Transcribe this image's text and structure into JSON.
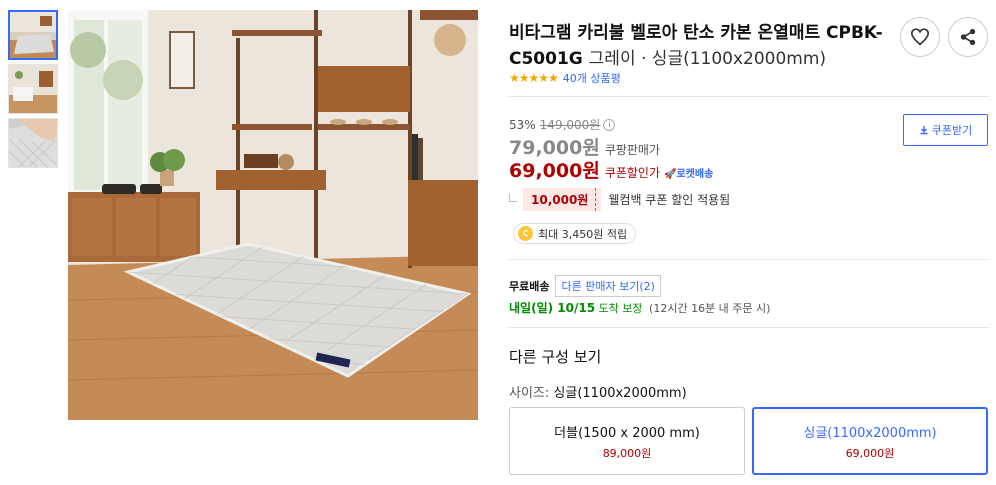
{
  "product": {
    "title_main": "비타그램 카리불 벨로아 탄소 카본 온열매트 CPBK-C5001G",
    "title_option": "그레이 · 싱글(1100x2000mm)",
    "stars": "★★★★★",
    "review_count": "40개 상품평"
  },
  "pricing": {
    "discount_rate": "53%",
    "original_price": "149,000원",
    "sale_price": "79,000원",
    "sale_label": "쿠팡판매가",
    "coupon_price": "69,000원",
    "coupon_label": "쿠폰할인가",
    "rocket_label": "🚀로켓배송",
    "coupon_button": "쿠폰받기",
    "welcome_coupon_amount": "10,000원",
    "welcome_coupon_text": "웰컴백 쿠폰 할인 적용됨",
    "reward_text": "최대 3,450원 적립",
    "coin_symbol": "C"
  },
  "shipping": {
    "free_label": "무료배송",
    "other_sellers": "다른 판매자 보기(2)",
    "arrival_date": "내일(일) 10/15",
    "arrival_text": "도착 보장",
    "cutoff_text": "(12시간 16분 내 주문 시)"
  },
  "options": {
    "section_title": "다른 구성 보기",
    "size_label": "사이즈:",
    "size_selected": "싱글(1100x2000mm)",
    "cards": [
      {
        "name": "더블(1500 x 2000 mm)",
        "price": "89,000원"
      },
      {
        "name": "싱글(1100x2000mm)",
        "price": "69,000원"
      }
    ]
  },
  "icons": {
    "heart": "heart-icon",
    "share": "share-icon",
    "download": "download-icon",
    "info": "info-icon"
  },
  "colors": {
    "accent_blue": "#346aff",
    "price_red": "#ae0000",
    "delivery_green": "#008c00",
    "star_gold": "#f6a600"
  }
}
